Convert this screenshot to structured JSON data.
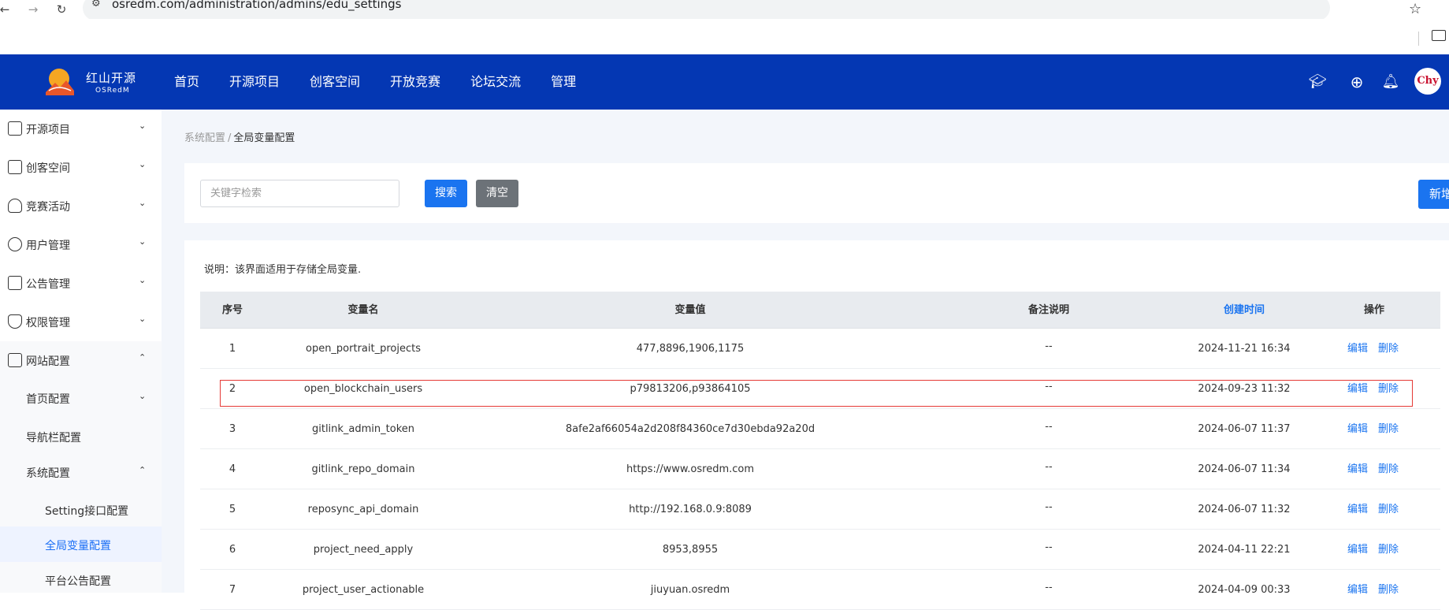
{
  "browser": {
    "url": "osredm.com/administration/admins/edu_settings"
  },
  "header": {
    "logo_cn": "红山开源",
    "logo_en": "OSRedM",
    "nav": [
      "首页",
      "开源项目",
      "创客空间",
      "开放竞赛",
      "论坛交流",
      "管理"
    ],
    "avatar_text": "Chy"
  },
  "sidebar": {
    "items": [
      {
        "label": "开源项目"
      },
      {
        "label": "创客空间"
      },
      {
        "label": "竞赛活动"
      },
      {
        "label": "用户管理"
      },
      {
        "label": "公告管理"
      },
      {
        "label": "权限管理"
      },
      {
        "label": "网站配置"
      }
    ],
    "sub": [
      {
        "label": "首页配置"
      },
      {
        "label": "导航栏配置"
      },
      {
        "label": "系统配置"
      }
    ],
    "sub3": [
      {
        "label": "Setting接口配置"
      },
      {
        "label": "全局变量配置"
      },
      {
        "label": "平台公告配置"
      }
    ]
  },
  "breadcrumb": {
    "parent": "系统配置",
    "sep": "/",
    "current": "全局变量配置"
  },
  "search": {
    "placeholder": "关键字检索",
    "search_label": "搜索",
    "clear_label": "清空",
    "new_label": "新增"
  },
  "table": {
    "description": "说明：该界面适用于存储全局变量.",
    "headers": [
      "序号",
      "变量名",
      "变量值",
      "备注说明",
      "创建时间",
      "操作"
    ],
    "rows": [
      {
        "no": "1",
        "name": "open_portrait_projects",
        "value": "477,8896,1906,1175",
        "note": "--",
        "time": "2024-11-21 16:34",
        "edit": "编辑",
        "del": "删除"
      },
      {
        "no": "2",
        "name": "open_blockchain_users",
        "value": "p79813206,p93864105",
        "note": "--",
        "time": "2024-09-23 11:32",
        "edit": "编辑",
        "del": "删除"
      },
      {
        "no": "3",
        "name": "gitlink_admin_token",
        "value": "8afe2af66054a2d208f84360ce7d30ebda92a20d",
        "note": "--",
        "time": "2024-06-07 11:37",
        "edit": "编辑",
        "del": "删除"
      },
      {
        "no": "4",
        "name": "gitlink_repo_domain",
        "value": "https://www.osredm.com",
        "note": "--",
        "time": "2024-06-07 11:34",
        "edit": "编辑",
        "del": "删除"
      },
      {
        "no": "5",
        "name": "reposync_api_domain",
        "value": "http://192.168.0.9:8089",
        "note": "--",
        "time": "2024-06-07 11:32",
        "edit": "编辑",
        "del": "删除"
      },
      {
        "no": "6",
        "name": "project_need_apply",
        "value": "8953,8955",
        "note": "--",
        "time": "2024-04-11 22:21",
        "edit": "编辑",
        "del": "删除"
      },
      {
        "no": "7",
        "name": "project_user_actionable",
        "value": "jiuyuan.osredm",
        "note": "--",
        "time": "2024-04-09 00:33",
        "edit": "编辑",
        "del": "删除"
      }
    ]
  },
  "colors": {
    "header_bg": "#0437b3",
    "primary": "#1a74f0",
    "clear_btn": "#6c7278",
    "highlight": "#e53935"
  }
}
